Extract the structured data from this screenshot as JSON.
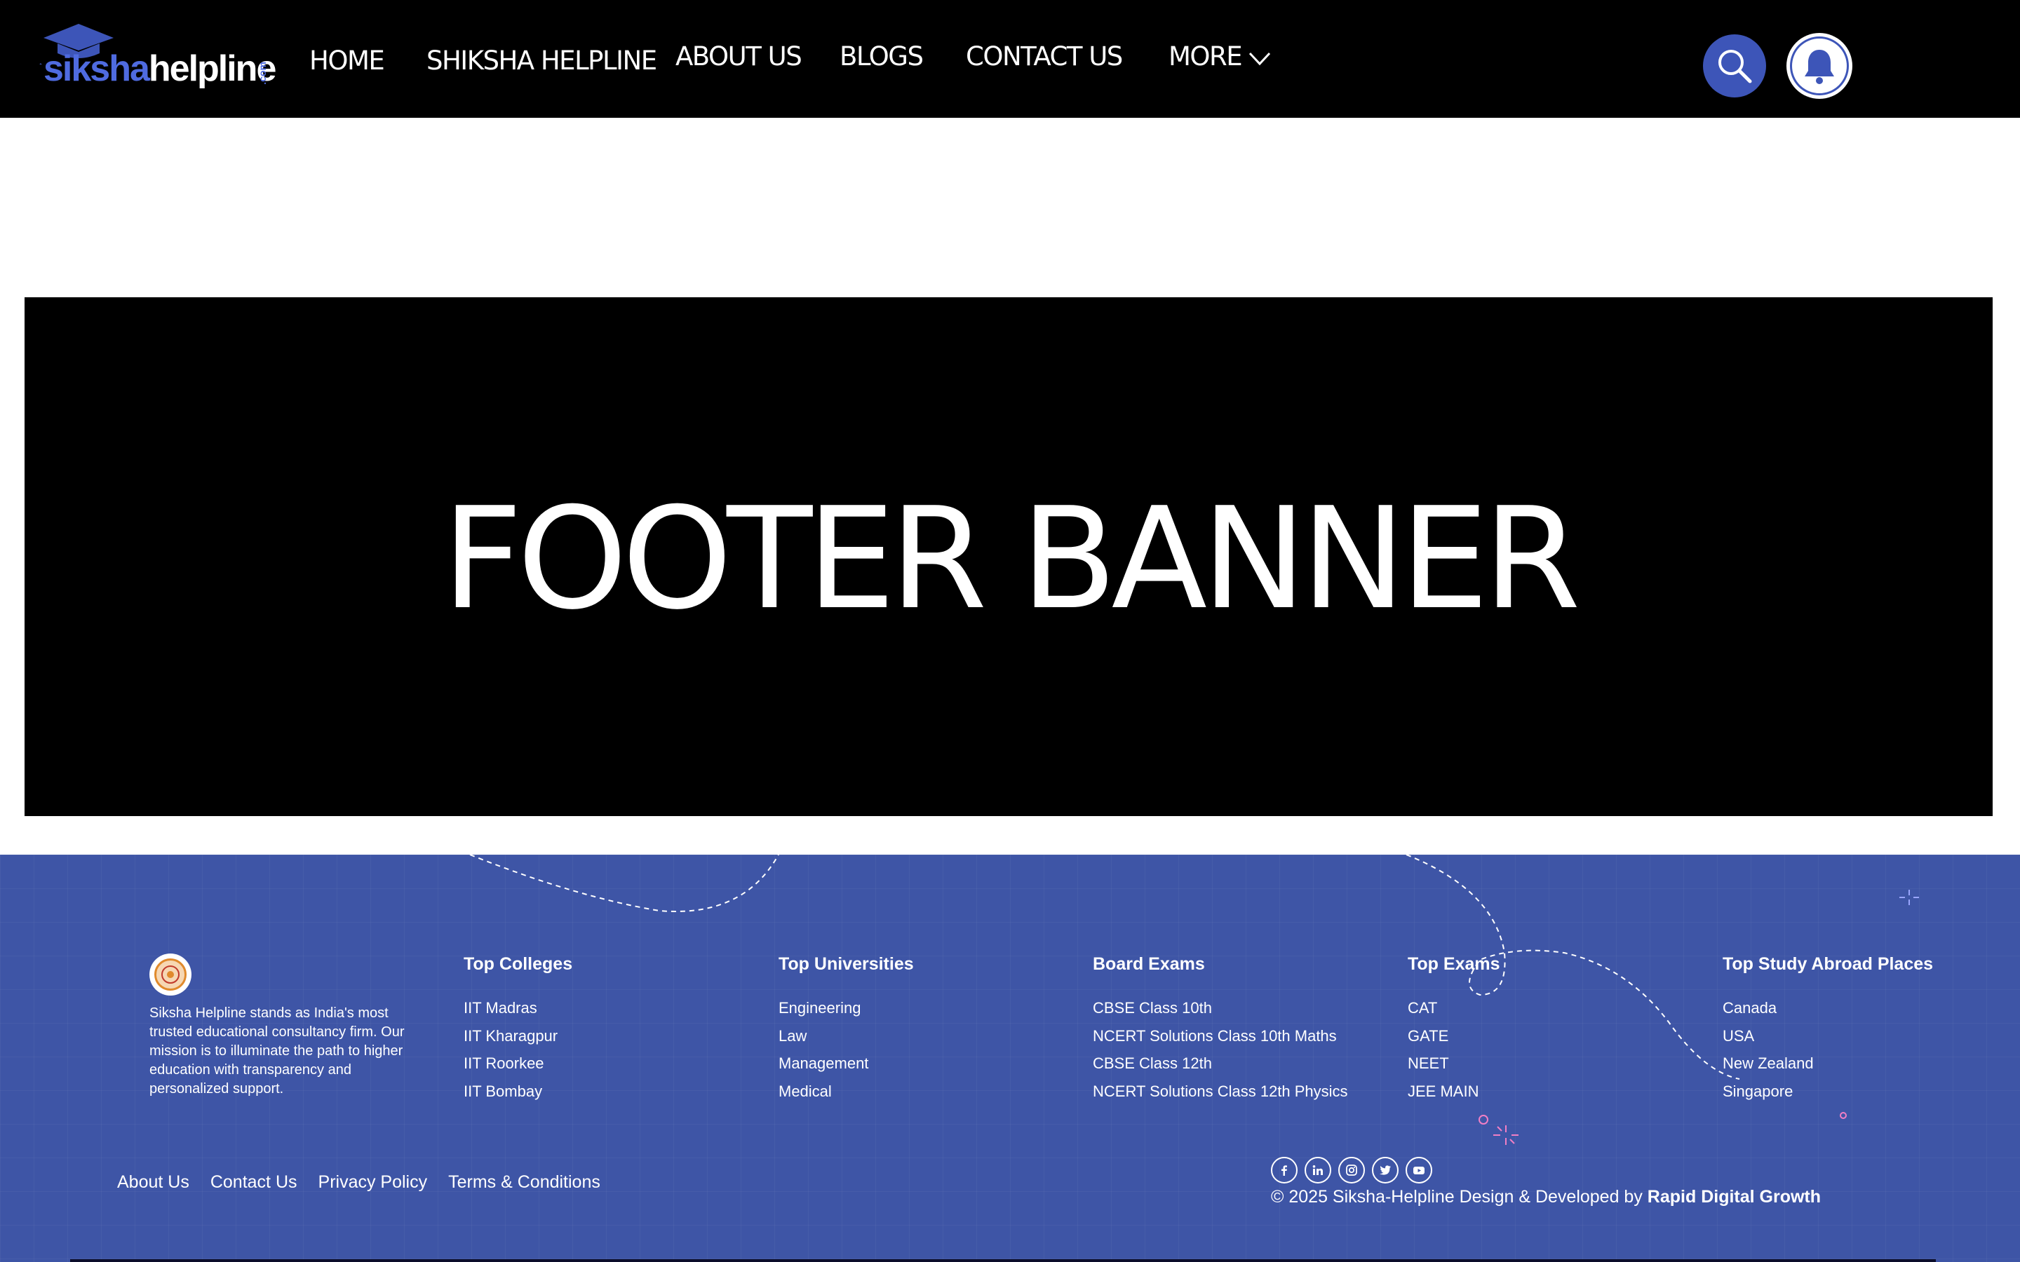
{
  "logo": {
    "part1": "siksha",
    "part2": "helpline",
    "suffix": ".com"
  },
  "nav": {
    "home": "HOME",
    "shiksha_helpline": "SHIKSHA HELPLINE",
    "about_us": "ABOUT US",
    "blogs": "BLOGS",
    "contact_us": "CONTACT US",
    "more": "MORE"
  },
  "header_icons": {
    "search": "search-icon",
    "notifications": "bell-icon"
  },
  "banner": {
    "title": "FOOTER BANNER"
  },
  "footer": {
    "about_text": "Siksha Helpline stands as India's most trusted educational consultancy firm. Our mission is to illuminate the path to higher education with transparency and personalized support.",
    "columns": [
      {
        "title": "Top Colleges",
        "items": [
          "IIT Madras",
          "IIT Kharagpur",
          "IIT Roorkee",
          "IIT Bombay"
        ]
      },
      {
        "title": "Top Universities",
        "items": [
          "Engineering",
          "Law",
          "Management",
          "Medical"
        ]
      },
      {
        "title": "Board Exams",
        "items": [
          "CBSE Class 10th",
          "NCERT Solutions Class 10th Maths",
          "CBSE Class 12th",
          "NCERT Solutions Class 12th Physics"
        ]
      },
      {
        "title": "Top Exams",
        "items": [
          "CAT",
          "GATE",
          "NEET",
          "JEE MAIN"
        ]
      },
      {
        "title": "Top Study Abroad Places",
        "items": [
          "Canada",
          "USA",
          "New Zealand",
          "Singapore"
        ]
      }
    ],
    "bottom_links": {
      "about": "About Us",
      "contact": "Contact Us",
      "privacy": "Privacy Policy",
      "terms": "Terms & Conditions"
    },
    "socials": [
      "facebook-icon",
      "linkedin-icon",
      "instagram-icon",
      "twitter-icon",
      "youtube-icon"
    ],
    "copyright_prefix": "© 2025 Siksha-Helpline Design & Developed by",
    "copyright_brand": "Rapid Digital Growth"
  },
  "colors": {
    "nav_bg": "#000000",
    "accent": "#3d55b8",
    "footer_bg": "#3e55a6",
    "banner_bg": "#000000"
  }
}
